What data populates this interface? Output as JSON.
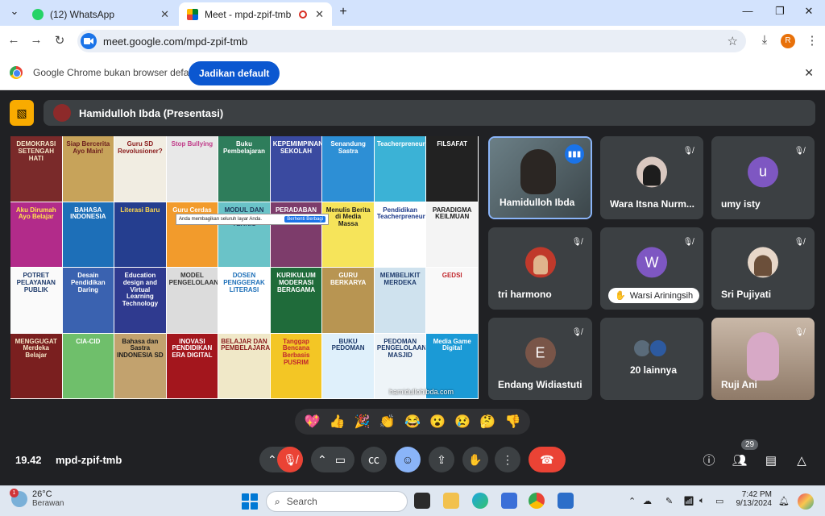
{
  "tabs": [
    {
      "title": "(12) WhatsApp",
      "icon": "whatsapp-icon",
      "active": false
    },
    {
      "title": "Meet - mpd-zpif-tmb",
      "icon": "meet-icon",
      "active": true
    }
  ],
  "window": {
    "minimize": "—",
    "restore": "❐",
    "close": "✕",
    "new_tab": "+",
    "tab_search": "⌄"
  },
  "toolbar": {
    "url": "meet.google.com/mpd-zpif-tmb",
    "profile_initial": "R"
  },
  "infobar": {
    "message": "Google Chrome bukan browser default",
    "button": "Jadikan default"
  },
  "meet": {
    "presenter_label": "Hamidulloh Ibda (Presentasi)",
    "share_banner": "Anda membagikan seluruh layar Anda.",
    "share_stop": "Berhenti Berbagi",
    "watermark": "hamidullohibda.com",
    "participants": [
      {
        "name": "Hamidulloh Ibda",
        "type": "video",
        "speaking": true
      },
      {
        "name": "Wara Itsna Nurm...",
        "type": "photo",
        "muted": true
      },
      {
        "name": "umy isty",
        "type": "letter",
        "initial": "u",
        "color": "#7e57c2",
        "muted": true
      },
      {
        "name": "tri harmono",
        "type": "photo",
        "muted": true
      },
      {
        "name": "Warsi Ariningsih",
        "type": "letter",
        "initial": "W",
        "color": "#7e57c2",
        "muted": true,
        "hand_raised": true
      },
      {
        "name": "Sri Pujiyati",
        "type": "photo",
        "muted": true
      },
      {
        "name": "Endang Widiastuti",
        "type": "letter",
        "initial": "E",
        "color": "#795548",
        "muted": true
      },
      {
        "name": "20 lainnya",
        "type": "group"
      },
      {
        "name": "Ruji Ani",
        "type": "video",
        "muted": true
      }
    ],
    "reactions": [
      "💖",
      "👍",
      "🎉",
      "👏",
      "😂",
      "😮",
      "😢",
      "🤔",
      "👎"
    ],
    "time": "19.42",
    "meeting_code": "mpd-zpif-tmb",
    "people_count": "29"
  },
  "covers": [
    {
      "title": "DEMOKRASI SETENGAH HATI",
      "bg": "#7a2a2a",
      "fg": "#f5e6c8"
    },
    {
      "title": "Siap Bercerita Ayo Main!",
      "bg": "#c7a35a",
      "fg": "#6b1d1d"
    },
    {
      "title": "Guru SD Revolusioner?",
      "bg": "#f1ede2",
      "fg": "#8a1c1c"
    },
    {
      "title": "Stop Bullying",
      "bg": "#e8e8e8",
      "fg": "#c13c8a"
    },
    {
      "title": "Buku Pembelajaran",
      "bg": "#2e7d5b",
      "fg": "#fff"
    },
    {
      "title": "KEPEMIMPINAN SEKOLAH",
      "bg": "#3a4aa0",
      "fg": "#fff"
    },
    {
      "title": "Senandung Sastra",
      "bg": "#2d8fd5",
      "fg": "#fff"
    },
    {
      "title": "Teacherpreneurship",
      "bg": "#3bb2d6",
      "fg": "#fff"
    },
    {
      "title": "FILSAFAT",
      "bg": "#222",
      "fg": "#fff"
    },
    {
      "title": "Aku Dirumah Ayo Belajar",
      "bg": "#b22b8a",
      "fg": "#ffe24d"
    },
    {
      "title": "BAHASA INDONESIA",
      "bg": "#1d6fb8",
      "fg": "#fff"
    },
    {
      "title": "Literasi Baru",
      "bg": "#253e8f",
      "fg": "#ffd84d"
    },
    {
      "title": "Guru Cerdas",
      "bg": "#f29b2c",
      "fg": "#fff"
    },
    {
      "title": "MODUL DAN PANDUAN TEKNIS",
      "bg": "#6ac3c8",
      "fg": "#1d3557"
    },
    {
      "title": "PERADABAN MAKAM",
      "bg": "#7d3c6b",
      "fg": "#fff"
    },
    {
      "title": "Menulis Berita di Media Massa",
      "bg": "#f6e45a",
      "fg": "#1d1d1d"
    },
    {
      "title": "Pendidikan Teacherpreneurship",
      "bg": "#fff",
      "fg": "#1d3a8a"
    },
    {
      "title": "PARADIGMA KEILMUAN",
      "bg": "#f4f4f4",
      "fg": "#1d1d1d"
    },
    {
      "title": "POTRET PELAYANAN PUBLIK",
      "bg": "#fafafa",
      "fg": "#1d3a6b"
    },
    {
      "title": "Desain Pendidikan Daring",
      "bg": "#3a62b0",
      "fg": "#fff"
    },
    {
      "title": "Education design and Virtual Learning Technology",
      "bg": "#2f3a8f",
      "fg": "#fff"
    },
    {
      "title": "MODEL PENGELOLAAN",
      "bg": "#dcdcdc",
      "fg": "#333"
    },
    {
      "title": "DOSEN PENGGERAK LITERASI",
      "bg": "#ffffff",
      "fg": "#1d6fb8"
    },
    {
      "title": "KURIKULUM MODERASI BERAGAMA",
      "bg": "#1f6b3a",
      "fg": "#fff"
    },
    {
      "title": "GURU BERKARYA",
      "bg": "#b89552",
      "fg": "#fff"
    },
    {
      "title": "MEMBELIKIT MERDEKA",
      "bg": "#cfe2ee",
      "fg": "#1d3a6b"
    },
    {
      "title": "GEDSI",
      "bg": "#f9f9f9",
      "fg": "#c1272d"
    },
    {
      "title": "MENGGUGAT Merdeka Belajar",
      "bg": "#7a1f1f",
      "fg": "#f5e6c8"
    },
    {
      "title": "CIA-CID",
      "bg": "#6fbf6b",
      "fg": "#fff"
    },
    {
      "title": "Bahasa dan Sastra INDONESIA SD",
      "bg": "#c2a26e",
      "fg": "#1d1d1d"
    },
    {
      "title": "INOVASI PENDIDIKAN ERA DIGITAL",
      "bg": "#a3161d",
      "fg": "#fff"
    },
    {
      "title": "BELAJAR DAN PEMBELAJARAN",
      "bg": "#f0e8c8",
      "fg": "#8a1c1c"
    },
    {
      "title": "Tanggap Bencana Berbasis PUSRIM",
      "bg": "#f3c625",
      "fg": "#c1272d"
    },
    {
      "title": "BUKU PEDOMAN",
      "bg": "#dff0fb",
      "fg": "#1d3a6b"
    },
    {
      "title": "PEDOMAN PENGELOLAAN MASJID",
      "bg": "#eef4f8",
      "fg": "#1d3a6b"
    },
    {
      "title": "Media Game Digital",
      "bg": "#1b9ad6",
      "fg": "#fff"
    }
  ],
  "taskbar": {
    "temp": "26°C",
    "condition": "Berawan",
    "notif_count": "1",
    "search_placeholder": "Search",
    "time": "7:42 PM",
    "date": "9/13/2024"
  }
}
